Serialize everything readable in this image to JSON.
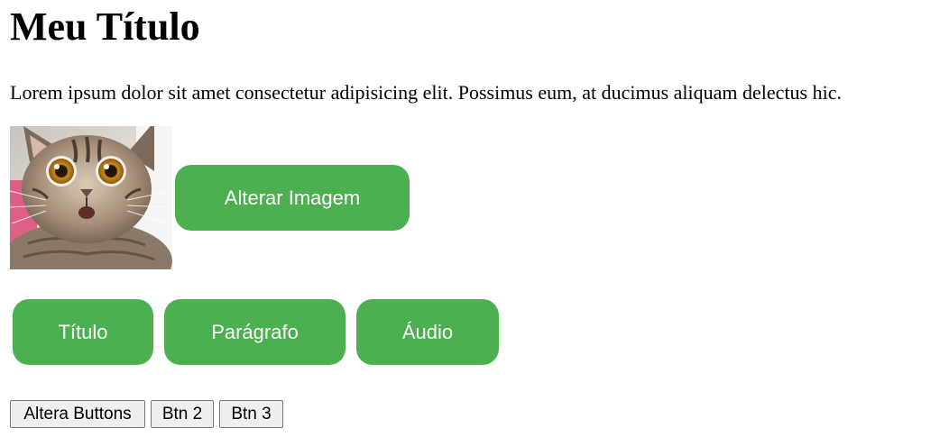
{
  "header": {
    "title": "Meu Título"
  },
  "content": {
    "paragraph": "Lorem ipsum dolor sit amet consectetur adipisicing elit. Possimus eum, at ducimus aliquam delectus hic."
  },
  "image": {
    "subject": "surprised-cat-photo"
  },
  "buttons": {
    "alterar_imagem": "Alterar Imagem",
    "titulo": "Título",
    "paragrafo": "Parágrafo",
    "audio": "Áudio",
    "altera_buttons": "Altera Buttons",
    "btn2": "Btn 2",
    "btn3": "Btn 3"
  },
  "colors": {
    "accent_green": "#4caf50",
    "button_text": "#ffffff"
  }
}
